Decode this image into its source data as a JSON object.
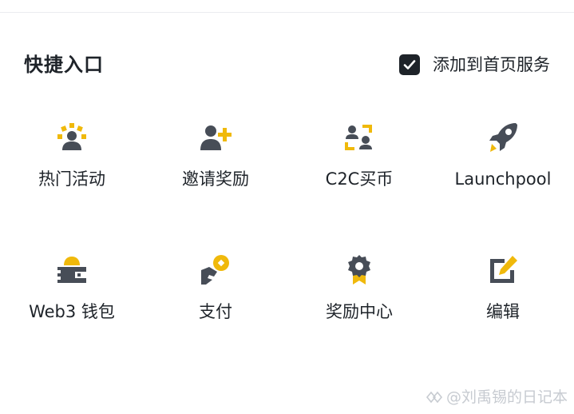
{
  "section": {
    "title": "快捷入口",
    "add_to_home_label": "添加到首页服务",
    "add_to_home_checked": true
  },
  "shortcuts": [
    {
      "label": "热门活动",
      "icon": "hot-events-icon"
    },
    {
      "label": "邀请奖励",
      "icon": "invite-user-icon"
    },
    {
      "label": "C2C买币",
      "icon": "c2c-users-icon"
    },
    {
      "label": "Launchpool",
      "icon": "rocket-icon"
    },
    {
      "label": "Web3 钱包",
      "icon": "wallet-icon"
    },
    {
      "label": "支付",
      "icon": "pay-icon"
    },
    {
      "label": "奖励中心",
      "icon": "reward-medal-icon"
    },
    {
      "label": "编辑",
      "icon": "edit-icon"
    }
  ],
  "watermark": {
    "text": "@刘禹锡的日记本"
  },
  "colors": {
    "dark": "#474d57",
    "accent": "#f0b90b",
    "text": "#1e2329"
  }
}
